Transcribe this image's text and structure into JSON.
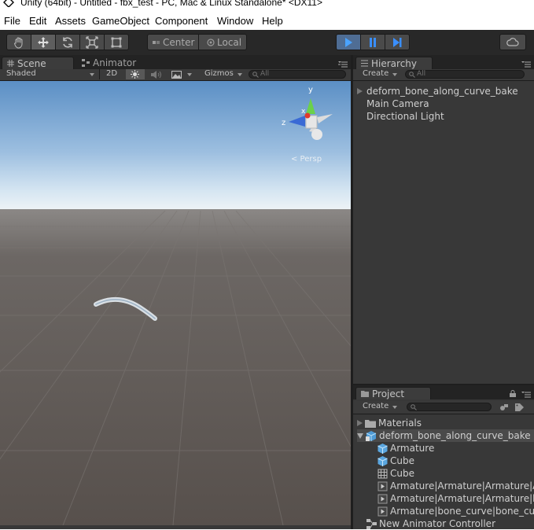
{
  "window": {
    "title": "Unity (64bit) - Untitled - fbx_test - PC, Mac & Linux Standalone* <DX11>"
  },
  "menu": [
    "File",
    "Edit",
    "Assets",
    "GameObject",
    "Component",
    "Window",
    "Help"
  ],
  "toolbar": {
    "tools": [
      "hand-tool",
      "move-tool",
      "rotate-tool",
      "scale-tool",
      "rect-tool"
    ],
    "pivot_mode": "Center",
    "pivot_rotation": "Local",
    "play_controls": [
      "play",
      "pause",
      "step"
    ]
  },
  "scene": {
    "tabs": [
      "Scene",
      "Animator"
    ],
    "draw_mode": "Shaded",
    "mode_2d": "2D",
    "gizmos": "Gizmos",
    "search_placeholder": "All",
    "persp_label": "< Persp",
    "gizmo_axes": {
      "y": "y",
      "x": "x",
      "z": "z"
    }
  },
  "hierarchy": {
    "tab": "Hierarchy",
    "create": "Create",
    "search_placeholder": "All",
    "items": [
      "deform_bone_along_curve_bake",
      "Main Camera",
      "Directional Light"
    ]
  },
  "project": {
    "tab": "Project",
    "create": "Create",
    "items": [
      {
        "label": "Materials",
        "icon": "folder-icon",
        "indent": 0,
        "arrow": "right"
      },
      {
        "label": "deform_bone_along_curve_bake",
        "icon": "model-icon",
        "indent": 0,
        "arrow": "down",
        "selected": true
      },
      {
        "label": "Armature",
        "icon": "cube-icon",
        "indent": 1
      },
      {
        "label": "Cube",
        "icon": "cube-icon",
        "indent": 1
      },
      {
        "label": "Cube",
        "icon": "mesh-icon",
        "indent": 1
      },
      {
        "label": "Armature|Armature|Armature|A",
        "icon": "animation-clip-icon",
        "indent": 1
      },
      {
        "label": "Armature|Armature|Armature|b",
        "icon": "animation-clip-icon",
        "indent": 1
      },
      {
        "label": "Armature|bone_curve|bone_cu",
        "icon": "animation-clip-icon",
        "indent": 1
      },
      {
        "label": "New Animator Controller",
        "icon": "animator-controller-icon",
        "indent": 0
      }
    ]
  },
  "colors": {
    "accent": "#3a7bd5",
    "toolbar": "#282828",
    "panel": "#383838",
    "sky_top": "#5a8fc4",
    "ground": "#5a5450"
  }
}
